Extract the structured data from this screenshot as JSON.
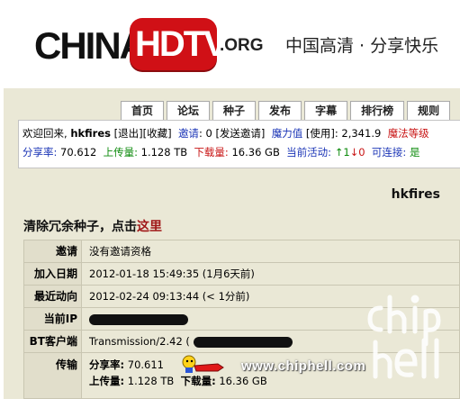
{
  "logo": {
    "china": "CHINA",
    "hdtv": "HDTV",
    "org": ".ORG"
  },
  "slogan": "中国高清 · 分享快乐",
  "nav": {
    "tabs": [
      "首页",
      "论坛",
      "种子",
      "发布",
      "字幕",
      "排行榜",
      "规则"
    ]
  },
  "infobar": {
    "welcome": "欢迎回来, ",
    "user": "hkfires",
    "logout": "[退出]",
    "favorites": "[收藏]",
    "invites_label": "邀请",
    "invites_value": ": 0 [发送邀请]",
    "bonus_label": "魔力值",
    "bonus_value": " [使用]: 2,341.9",
    "bonus_extra": "魔法等级",
    "ratio_label": "分享率:",
    "ratio_value": " 70.612",
    "uploaded_label": "上传量:",
    "uploaded_value": " 1.128 TB",
    "downloaded_label": "下载量:",
    "downloaded_value": " 16.36 GB",
    "active_label": "当前活动:",
    "active_up": "↑1",
    "active_down": "↓0",
    "connectable_label": "可连接:",
    "connectable_value": "是"
  },
  "profile": {
    "username": "hkfires",
    "cleanup_text": "清除冗余种子，点击",
    "cleanup_link": "这里",
    "rows": {
      "invite_label": "邀请",
      "invite_value": "没有邀请资格",
      "joined_label": "加入日期",
      "joined_value": "2012-01-18 15:49:35 (1月6天前)",
      "last_label": "最近动向",
      "last_value": "2012-02-24 09:13:44 (< 1分前)",
      "ip_label": "当前IP",
      "bt_label": "BT客户端",
      "bt_value": "Transmission/2.42 (",
      "transfer_label": "传输",
      "ratio_label": "分享率:",
      "ratio_value": " 70.611",
      "up_label": "上传量:",
      "up_value": " 1.128 TB",
      "down_label": "下载量:",
      "down_value": " 16.36 GB"
    }
  },
  "watermark": {
    "url": "www.chiphell.com",
    "logo": "chip hell"
  },
  "icons": {
    "mascot": "flying-mascot-icon"
  },
  "colors": {
    "brand_red": "#d01016",
    "bg_beige": "#eae8d6",
    "link_blue": "#1a34b6",
    "green": "#0b8a0b",
    "red": "#c81414"
  }
}
